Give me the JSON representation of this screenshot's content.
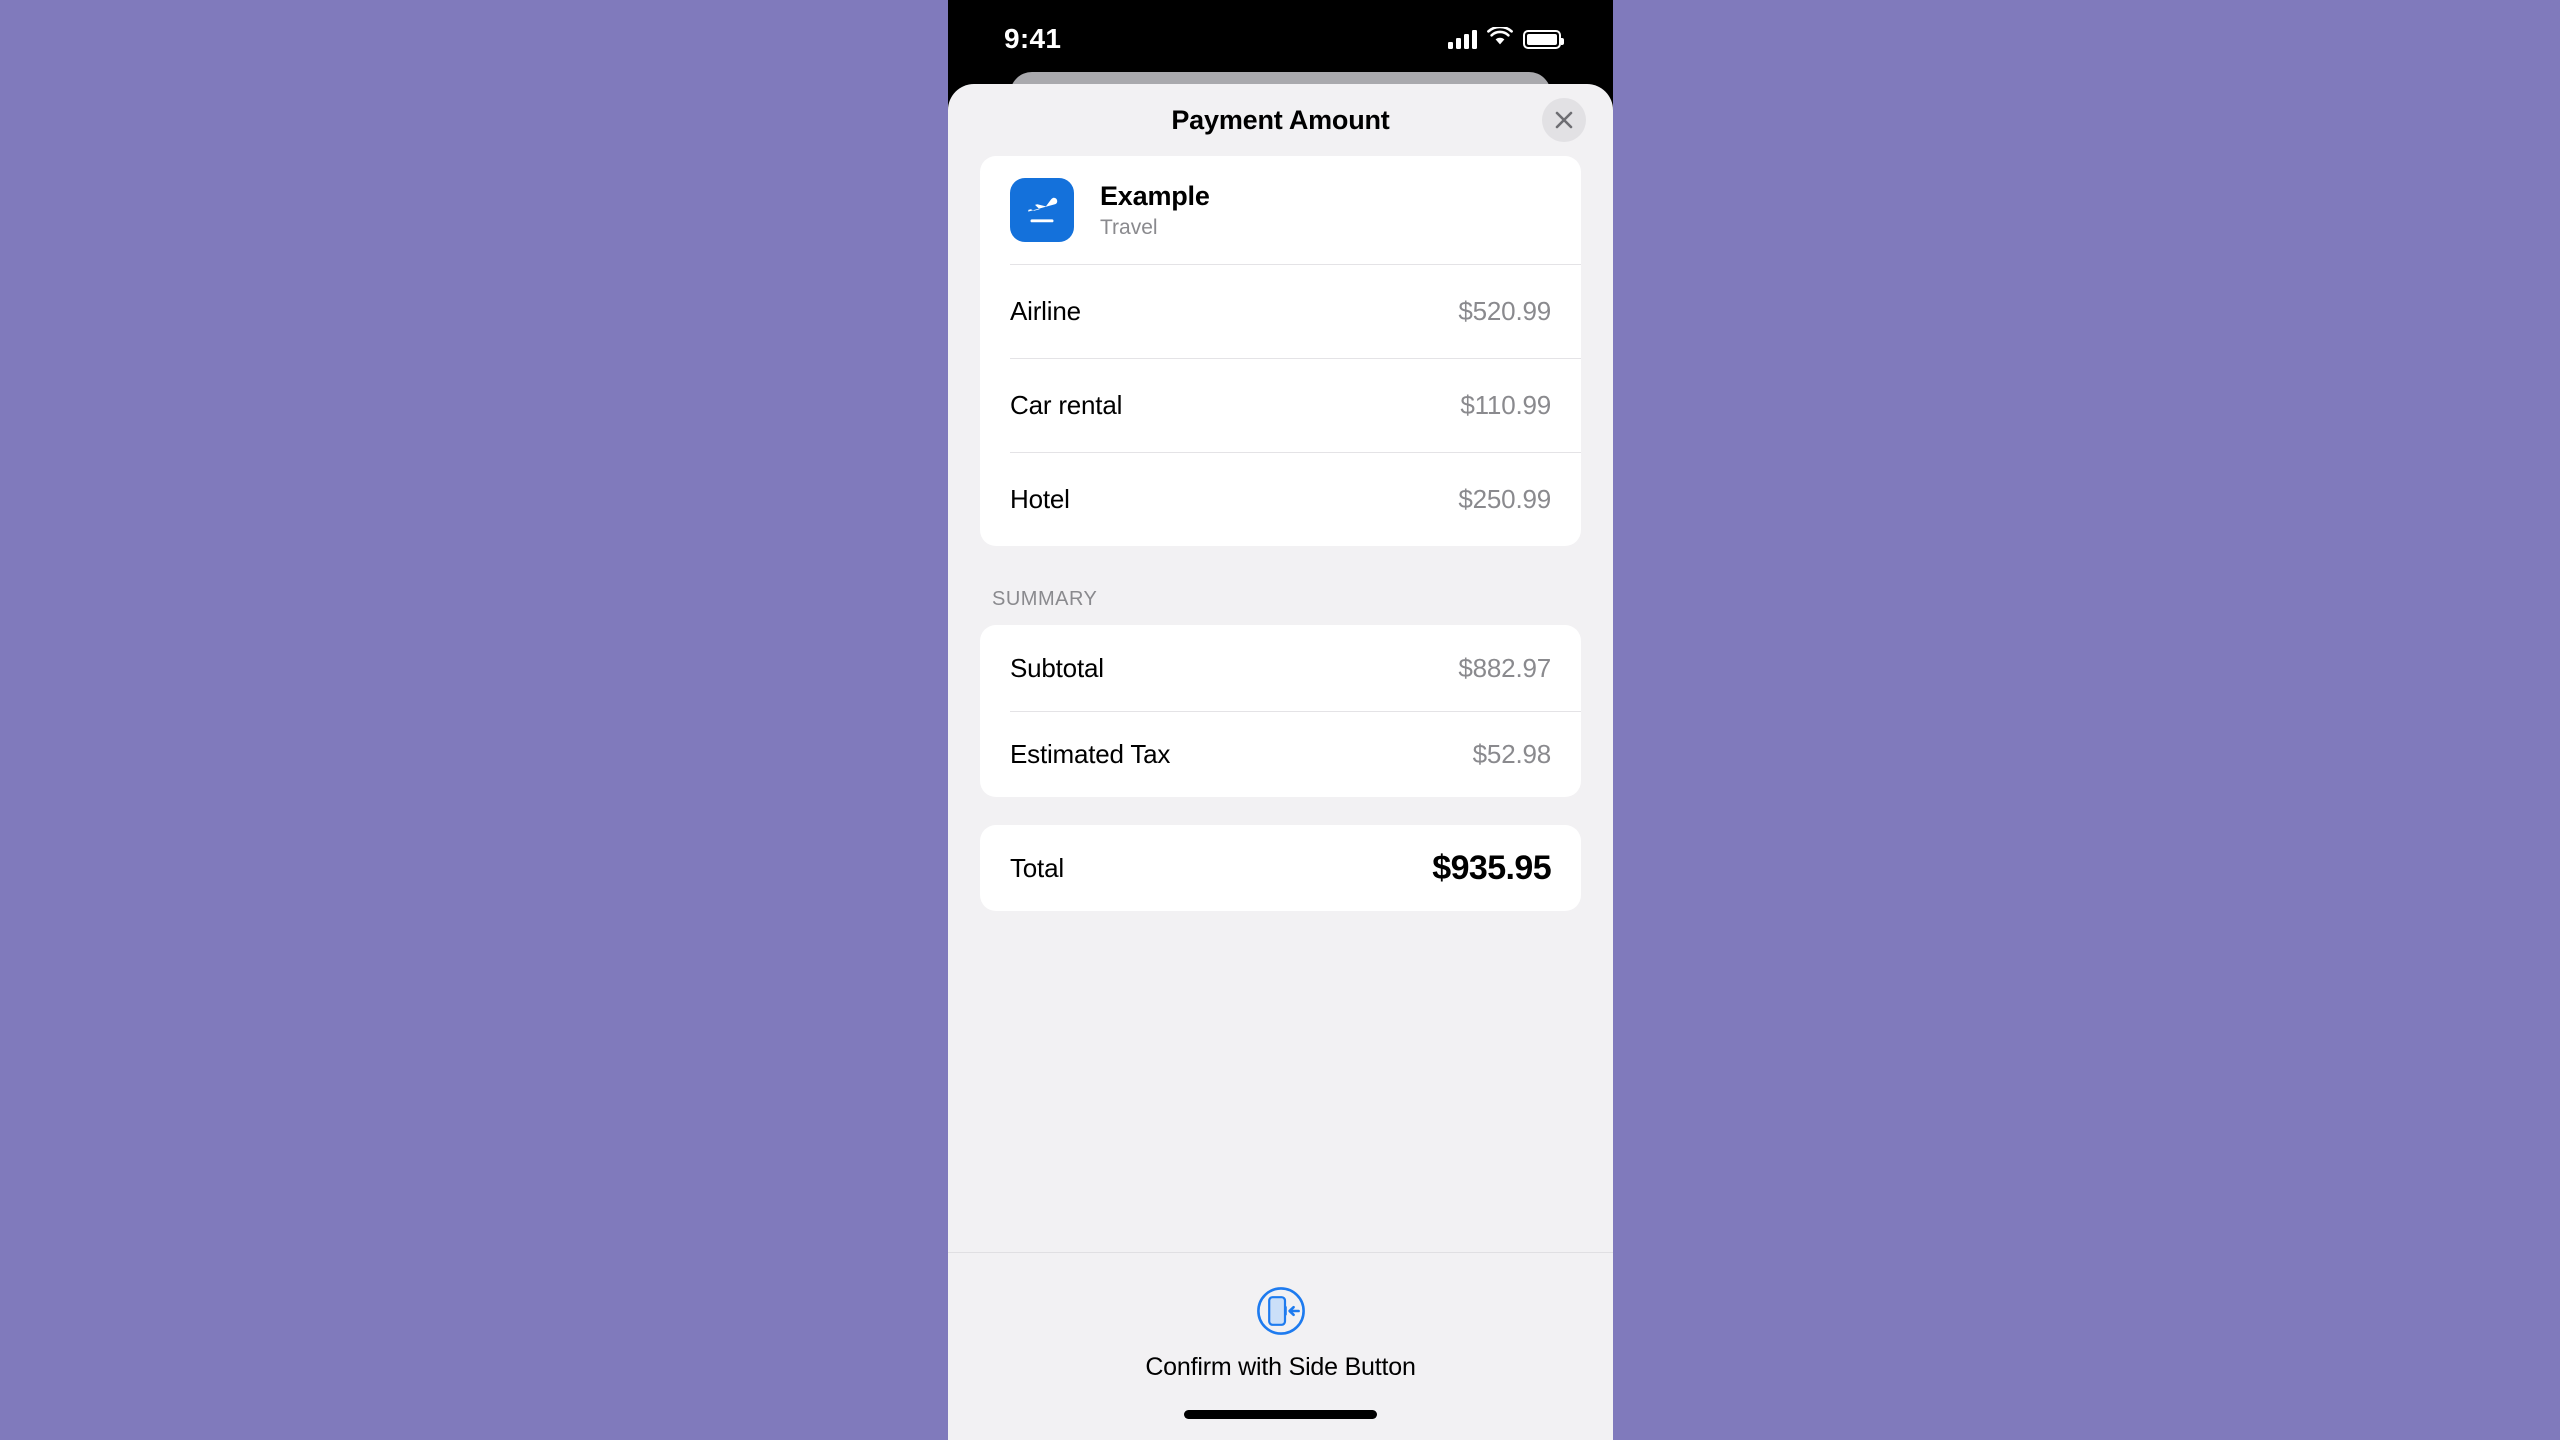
{
  "theme": {
    "background": "#807ABC",
    "sheet_bg": "#F2F1F3",
    "card_bg": "#FFFFFF",
    "accent_blue": "#1471DB",
    "icon_blue": "#1E7BEF",
    "muted_text": "#8A8A8E",
    "close_button_bg": "#E2E1E4",
    "stack_card": "#A9A9AD"
  },
  "status_bar": {
    "time": "9:41",
    "cellular_icon": "cellular-bars-icon",
    "wifi_icon": "wifi-icon",
    "battery_icon": "battery-icon"
  },
  "sheet": {
    "title": "Payment Amount",
    "close_icon": "close-icon"
  },
  "merchant": {
    "icon": "airplane-takeoff-icon",
    "name": "Example",
    "category": "Travel"
  },
  "line_items": [
    {
      "label": "Airline",
      "value": "$520.99"
    },
    {
      "label": "Car rental",
      "value": "$110.99"
    },
    {
      "label": "Hotel",
      "value": "$250.99"
    }
  ],
  "summary": {
    "heading": "SUMMARY",
    "rows": [
      {
        "label": "Subtotal",
        "value": "$882.97"
      },
      {
        "label": "Estimated Tax",
        "value": "$52.98"
      }
    ]
  },
  "total": {
    "label": "Total",
    "value": "$935.95"
  },
  "footer": {
    "icon": "side-button-confirm-icon",
    "text": "Confirm with Side Button",
    "home_indicator": "home-indicator"
  }
}
